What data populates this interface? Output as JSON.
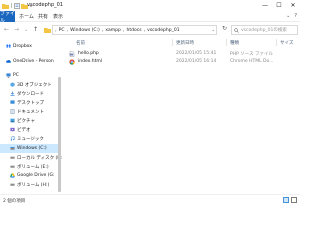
{
  "window": {
    "title": "vscodephp_01",
    "controls": [
      "—",
      "☐",
      "✕"
    ]
  },
  "ribbon": {
    "tabs": [
      "ファイル",
      "ホーム",
      "共有",
      "表示"
    ],
    "right": [
      "⌄",
      "?"
    ]
  },
  "address": {
    "nav": [
      "←",
      "→",
      "⌄",
      "↑"
    ],
    "crumbs": [
      "PC",
      "Windows (C:)",
      "xampp",
      "htdocs",
      "vscodephp_01"
    ],
    "separator": "›",
    "refresh": "↻",
    "search_placeholder": "vscodephp_01の検索"
  },
  "sidebar": {
    "items": [
      {
        "label": "Dropbox",
        "icon": "dropbox-icon",
        "color": "#0061fe"
      },
      {
        "label": "OneDrive - Person",
        "icon": "onedrive-icon",
        "color": "#0a64d2"
      },
      {
        "label": "PC",
        "icon": "pc-icon",
        "color": "#3a86d6"
      },
      {
        "label": "3D オブジェクト",
        "icon": "cube-icon",
        "color": "#5aa9e6"
      },
      {
        "label": "ダウンロード",
        "icon": "download-icon",
        "color": "#2f7bd3"
      },
      {
        "label": "デスクトップ",
        "icon": "desktop-icon",
        "color": "#3b8ed8"
      },
      {
        "label": "ドキュメント",
        "icon": "document-icon",
        "color": "#6f8fb3"
      },
      {
        "label": "ピクチャ",
        "icon": "picture-icon",
        "color": "#4aa3df"
      },
      {
        "label": "ビデオ",
        "icon": "video-icon",
        "color": "#7a62c9"
      },
      {
        "label": "ミュージック",
        "icon": "music-icon",
        "color": "#2e7fd6"
      },
      {
        "label": "Windows (C:)",
        "icon": "drive-icon",
        "color": "#6b6b6b",
        "selected": true
      },
      {
        "label": "ローカル ディスク (D:",
        "icon": "drive-icon",
        "color": "#6b6b6b"
      },
      {
        "label": "ボリューム (E:)",
        "icon": "drive-icon",
        "color": "#6b6b6b"
      },
      {
        "label": "Google Drive (G:",
        "icon": "google-drive-icon",
        "color": "#1aa260"
      },
      {
        "label": "ボリューム (H:)",
        "icon": "drive-icon",
        "color": "#6b6b6b"
      }
    ]
  },
  "table": {
    "headers": [
      "名前",
      "更新日時",
      "種類",
      "サイズ"
    ],
    "rows": [
      {
        "name": "hello.php",
        "date": "2022/01/05 15:41",
        "type": "PHP ソース ファイル",
        "size": "",
        "icon": "php-file-icon"
      },
      {
        "name": "index.html",
        "date": "2022/01/05 16:14",
        "type": "Chrome HTML Do...",
        "size": "",
        "icon": "chrome-html-icon"
      }
    ]
  },
  "status": {
    "text": "2 個の項目"
  },
  "colors": {
    "accent": "#1a67bf",
    "selection": "#cce8ff",
    "header_text": "#4c607a"
  }
}
